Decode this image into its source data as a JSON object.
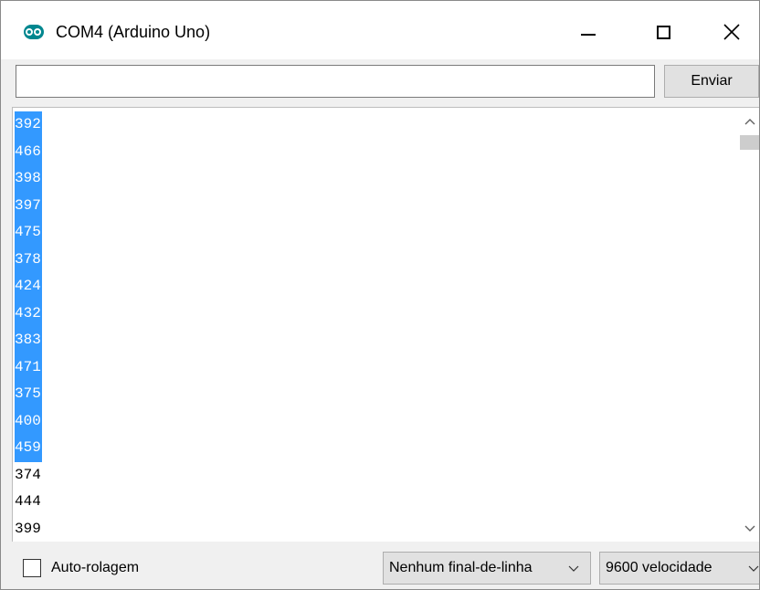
{
  "window": {
    "title": "COM4 (Arduino Uno)",
    "icon": "arduino-logo-icon"
  },
  "controls": {
    "minimize_icon": "minimize-icon",
    "maximize_icon": "maximize-icon",
    "close_icon": "close-icon"
  },
  "input_row": {
    "input_value": "",
    "send_label": "Enviar"
  },
  "output": {
    "lines": [
      {
        "text": "392",
        "selected": true
      },
      {
        "text": "466",
        "selected": true
      },
      {
        "text": "398",
        "selected": true
      },
      {
        "text": "397",
        "selected": true
      },
      {
        "text": "475",
        "selected": true
      },
      {
        "text": "378",
        "selected": true
      },
      {
        "text": "424",
        "selected": true
      },
      {
        "text": "432",
        "selected": true
      },
      {
        "text": "383",
        "selected": true
      },
      {
        "text": "471",
        "selected": true
      },
      {
        "text": "375",
        "selected": true
      },
      {
        "text": "400",
        "selected": true
      },
      {
        "text": "459",
        "selected": true
      },
      {
        "text": "374",
        "selected": false
      },
      {
        "text": "444",
        "selected": false
      },
      {
        "text": "399",
        "selected": false
      }
    ],
    "selection_color": "#3399ff"
  },
  "bottom": {
    "autoscroll_label": "Auto-rolagem",
    "autoscroll_checked": false,
    "line_ending_value": "Nenhum final-de-linha",
    "baud_value": "9600 velocidade"
  }
}
